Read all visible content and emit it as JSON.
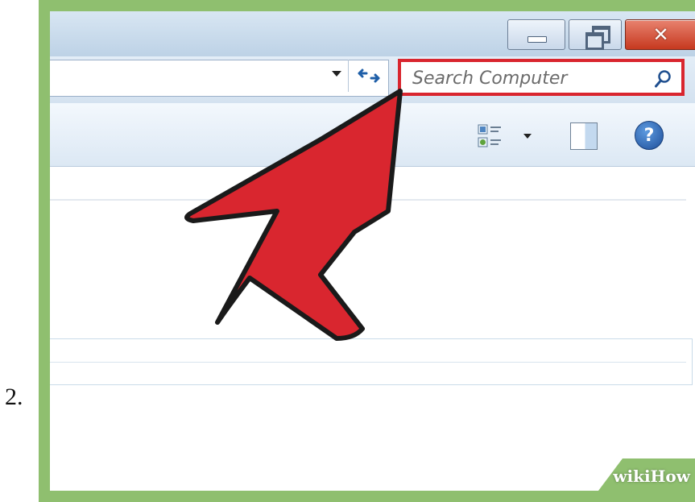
{
  "step": {
    "number": "2."
  },
  "window": {
    "controls": {
      "minimize_icon": "minimize-icon",
      "restore_icon": "restore-icon",
      "close_icon": "close-icon"
    }
  },
  "address_bar": {
    "value": "",
    "dropdown_icon": "chevron-down-icon",
    "refresh_icon": "refresh-icon"
  },
  "search": {
    "placeholder": "Search Computer",
    "icon": "search-icon"
  },
  "toolbar": {
    "views_icon": "change-view-icon",
    "preview_pane_icon": "preview-pane-icon",
    "help_icon": "help-icon",
    "help_glyph": "?"
  },
  "annotation": {
    "arrow_color": "#d9262f",
    "highlight_color": "#d9262f"
  },
  "watermark": {
    "text": "wikiHow"
  },
  "colors": {
    "frame": "#8fbf6f",
    "titlebar": "#c9dbec",
    "close_button": "#c6391f"
  }
}
